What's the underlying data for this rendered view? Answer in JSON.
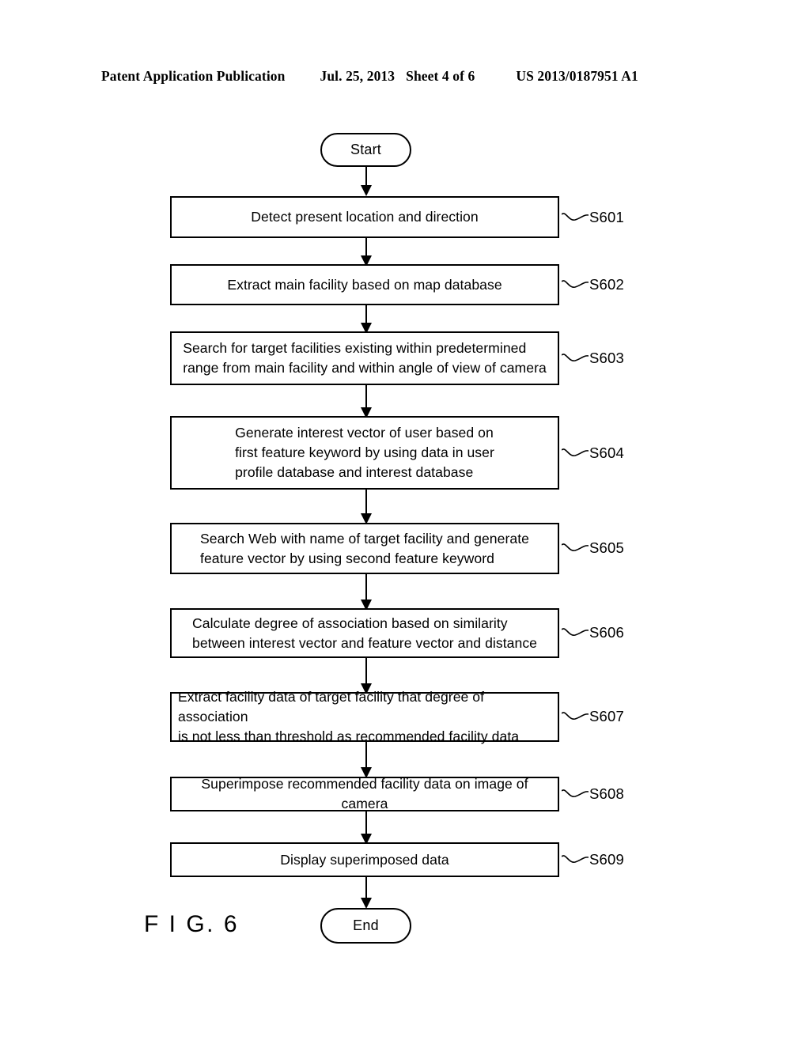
{
  "header": {
    "publication": "Patent Application Publication",
    "date": "Jul. 25, 2013",
    "sheet": "Sheet 4 of 6",
    "patent_number": "US 2013/0187951 A1"
  },
  "figure": {
    "caption": "F I G. 6"
  },
  "flowchart": {
    "start_label": "Start",
    "end_label": "End",
    "steps": [
      {
        "ref": "S601",
        "text": "Detect present location and direction"
      },
      {
        "ref": "S602",
        "text": "Extract main facility based on map database"
      },
      {
        "ref": "S603",
        "text": "Search for target facilities existing within predetermined\nrange from main facility and within angle of view of camera"
      },
      {
        "ref": "S604",
        "text": "Generate interest vector of user based on\nfirst feature keyword by using data in user\nprofile database and interest database"
      },
      {
        "ref": "S605",
        "text": "Search Web with name of target facility and generate\nfeature vector by using second feature keyword"
      },
      {
        "ref": "S606",
        "text": "Calculate degree of association based on similarity\nbetween interest vector and feature vector and distance"
      },
      {
        "ref": "S607",
        "text": "Extract facility data of target facility that degree of association\nis not less than threshold as recommended facility data"
      },
      {
        "ref": "S608",
        "text": "Superimpose recommended facility data on image of camera"
      },
      {
        "ref": "S609",
        "text": "Display superimposed data"
      }
    ]
  }
}
